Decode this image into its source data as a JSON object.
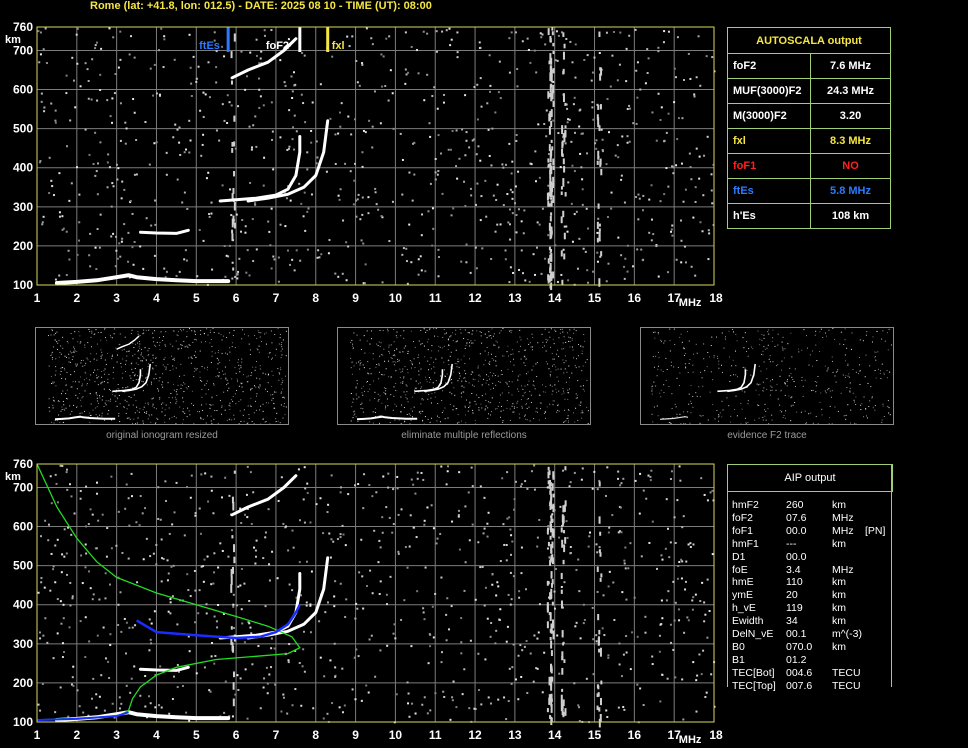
{
  "header": "Rome (lat: +41.8, lon: 012.5) - DATE: 2025 08 10 - TIME (UT): 08:00",
  "colors": {
    "grid": "#7c7c7c",
    "frame": "#d8d85a",
    "trace": "#ffffff",
    "noise": "#b0b0b0",
    "fxl": "#f5e642",
    "ftes": "#2b7bff",
    "fof1": "#ff2020",
    "profile_green": "#22dd22",
    "profile_blue": "#1a2cff",
    "box_border": "#9fce74"
  },
  "chart_data": [
    {
      "type": "scatter",
      "name": "main-ionogram",
      "xlabel": "MHz",
      "ylabel": "km",
      "xlim": [
        1,
        18
      ],
      "ylim": [
        100,
        760
      ],
      "x_ticks": [
        "1",
        "2",
        "3",
        "4",
        "5",
        "6",
        "7",
        "8",
        "9",
        "10",
        "11",
        "12",
        "13",
        "14",
        "15",
        "16",
        "17",
        "18"
      ],
      "y_ticks": [
        "100",
        "200",
        "300",
        "400",
        "500",
        "600",
        "700",
        "760"
      ],
      "markers": [
        {
          "label": "ftEs",
          "x": 5.8,
          "color": "#2b7bff"
        },
        {
          "label": "foF2",
          "x": 7.6,
          "color": "#ffffff"
        },
        {
          "label": "fxl",
          "x": 8.3,
          "color": "#f5e642"
        }
      ],
      "traces": {
        "es": [
          [
            1.5,
            105
          ],
          [
            2,
            108
          ],
          [
            2.5,
            112
          ],
          [
            3,
            120
          ],
          [
            3.3,
            125
          ],
          [
            3.5,
            120
          ],
          [
            4,
            115
          ],
          [
            4.5,
            112
          ],
          [
            5,
            110
          ],
          [
            5.8,
            110
          ]
        ],
        "es_multiple": [
          [
            3.6,
            235
          ],
          [
            4,
            233
          ],
          [
            4.5,
            232
          ],
          [
            4.8,
            240
          ]
        ],
        "o_trace": [
          [
            5.6,
            315
          ],
          [
            6,
            318
          ],
          [
            6.5,
            322
          ],
          [
            7,
            330
          ],
          [
            7.3,
            345
          ],
          [
            7.5,
            380
          ],
          [
            7.6,
            440
          ],
          [
            7.6,
            480
          ]
        ],
        "x_trace": [
          [
            6.3,
            315
          ],
          [
            6.8,
            322
          ],
          [
            7.3,
            332
          ],
          [
            7.7,
            350
          ],
          [
            8,
            380
          ],
          [
            8.2,
            440
          ],
          [
            8.3,
            520
          ]
        ],
        "multiple_f": [
          [
            5.9,
            630
          ],
          [
            6.3,
            650
          ],
          [
            6.8,
            670
          ],
          [
            7.2,
            700
          ],
          [
            7.5,
            730
          ]
        ]
      }
    },
    {
      "type": "scatter",
      "name": "aip-ionogram",
      "xlabel": "MHz",
      "ylabel": "km",
      "xlim": [
        1,
        18
      ],
      "ylim": [
        100,
        760
      ],
      "x_ticks": [
        "1",
        "2",
        "3",
        "4",
        "5",
        "6",
        "7",
        "8",
        "9",
        "10",
        "11",
        "12",
        "13",
        "14",
        "15",
        "16",
        "17",
        "18"
      ],
      "y_ticks": [
        "100",
        "200",
        "300",
        "400",
        "500",
        "600",
        "700",
        "760"
      ],
      "green_profile": [
        [
          1,
          760
        ],
        [
          1.5,
          650
        ],
        [
          2,
          570
        ],
        [
          2.5,
          510
        ],
        [
          3,
          470
        ],
        [
          4,
          430
        ],
        [
          5,
          400
        ],
        [
          6,
          370
        ],
        [
          6.8,
          345
        ],
        [
          7.4,
          318
        ],
        [
          7.6,
          290
        ],
        [
          7.3,
          275
        ],
        [
          6.5,
          268
        ],
        [
          5.5,
          260
        ],
        [
          4.5,
          240
        ],
        [
          4,
          220
        ],
        [
          3.6,
          190
        ],
        [
          3.4,
          160
        ],
        [
          3.3,
          130
        ],
        [
          3.1,
          118
        ],
        [
          2.5,
          112
        ],
        [
          1.5,
          108
        ],
        [
          1,
          105
        ]
      ],
      "blue_profile": [
        [
          3.5,
          360
        ],
        [
          4,
          330
        ],
        [
          5,
          322
        ],
        [
          6,
          315
        ],
        [
          6.6,
          318
        ],
        [
          7,
          330
        ],
        [
          7.3,
          350
        ],
        [
          7.5,
          380
        ],
        [
          7.6,
          400
        ]
      ],
      "blue_low": [
        [
          1,
          105
        ],
        [
          2,
          108
        ],
        [
          3,
          115
        ],
        [
          3.3,
          125
        ]
      ]
    }
  ],
  "thumbnails": [
    {
      "caption": "original ionogram resized"
    },
    {
      "caption": "eliminate multiple reflections"
    },
    {
      "caption": "evidence F2 trace"
    }
  ],
  "autoscala": {
    "title": "AUTOSCALA output",
    "rows": [
      {
        "label": "foF2",
        "value": "7.6 MHz",
        "color": "#ffffff"
      },
      {
        "label": "MUF(3000)F2",
        "value": "24.3 MHz",
        "color": "#ffffff"
      },
      {
        "label": "M(3000)F2",
        "value": "3.20",
        "color": "#ffffff"
      },
      {
        "label": "fxl",
        "value": "8.3 MHz",
        "color": "#f5e642"
      },
      {
        "label": "foF1",
        "value": "NO",
        "color": "#ff2020"
      },
      {
        "label": "ftEs",
        "value": "5.8 MHz",
        "color": "#2b7bff"
      },
      {
        "label": "h'Es",
        "value": "108      km",
        "color": "#ffffff"
      }
    ]
  },
  "aip": {
    "title": "AIP output",
    "rows": [
      {
        "name": "hmF2",
        "value": "260",
        "unit": "km",
        "extra": ""
      },
      {
        "name": "foF2",
        "value": "07.6",
        "unit": "MHz",
        "extra": ""
      },
      {
        "name": "foF1",
        "value": "00.0",
        "unit": "MHz",
        "extra": "[PN]"
      },
      {
        "name": "hmF1",
        "value": "---",
        "unit": "km",
        "extra": ""
      },
      {
        "name": "D1",
        "value": "00.0",
        "unit": "",
        "extra": ""
      },
      {
        "name": "foE",
        "value": "3.4",
        "unit": "MHz",
        "extra": ""
      },
      {
        "name": "hmE",
        "value": "110",
        "unit": "km",
        "extra": ""
      },
      {
        "name": "ymE",
        "value": "20",
        "unit": "km",
        "extra": ""
      },
      {
        "name": "h_vE",
        "value": "119",
        "unit": "km",
        "extra": ""
      },
      {
        "name": "Ewidth",
        "value": "34",
        "unit": "km",
        "extra": ""
      },
      {
        "name": "DelN_vE",
        "value": "00.1",
        "unit": "m^(-3)",
        "extra": ""
      },
      {
        "name": "B0",
        "value": "070.0",
        "unit": "km",
        "extra": ""
      },
      {
        "name": "B1",
        "value": "01.2",
        "unit": "",
        "extra": ""
      },
      {
        "name": "TEC[Bot]",
        "value": "004.6",
        "unit": "TECU",
        "extra": ""
      },
      {
        "name": "TEC[Top]",
        "value": "007.6",
        "unit": "TECU",
        "extra": ""
      }
    ]
  }
}
